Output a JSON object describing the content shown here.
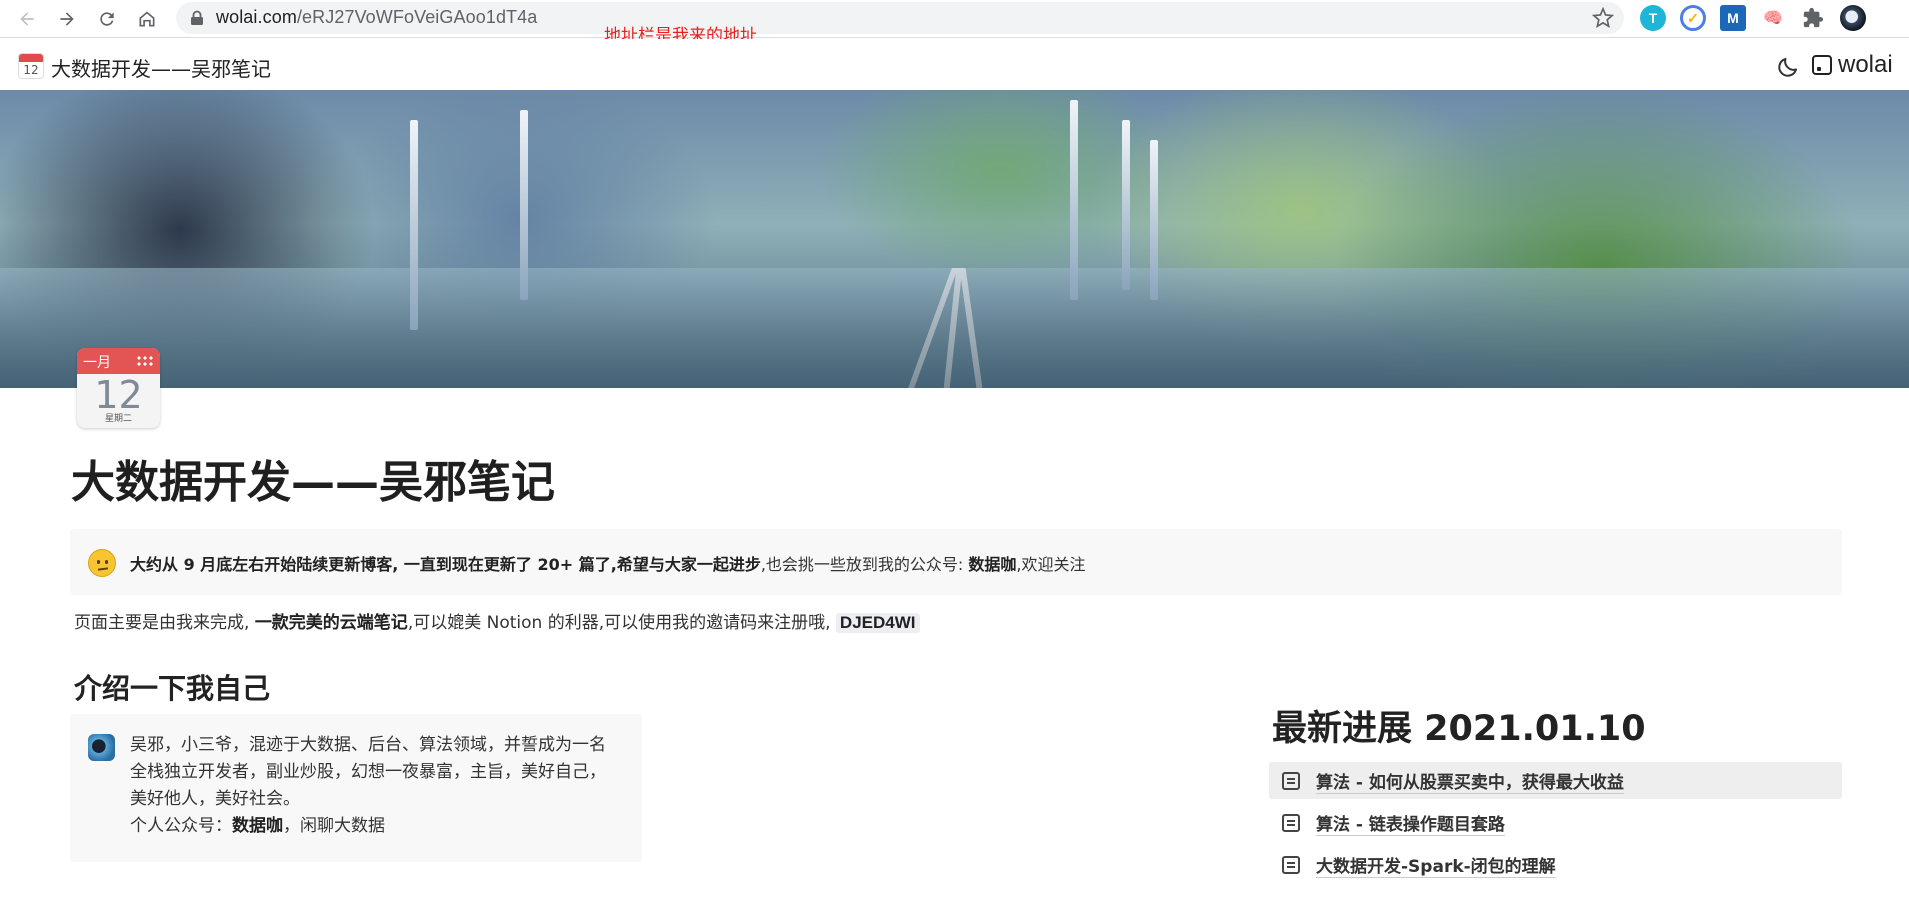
{
  "browser": {
    "url_host": "wolai.com",
    "url_path": "/eRJ27VoWFoVeiGAoo1dT4a",
    "annotation": "地址栏是我来的地址",
    "extensions": [
      "T",
      "✓",
      "M",
      "🧠"
    ]
  },
  "topbar": {
    "icon_day": "12",
    "title": "大数据开发——吴邪笔记",
    "brand": "wolai"
  },
  "page": {
    "icon": {
      "month": "一月",
      "day": "12",
      "weekday": "星期二"
    },
    "title": "大数据开发——吴邪笔记",
    "callout": {
      "bold1": "大约从 9 月底左右开始陆续更新博客, 一直到现在更新了 20+ 篇了,希望与大家一起进步",
      "normal1": ",也会挑一些放到我的公众号: ",
      "bold2": "数据咖",
      "normal2": ",欢迎关注"
    },
    "para": {
      "normal1": "页面主要是由我来完成, ",
      "bold1": "一款完美的云端笔记",
      "normal2": ",可以媲美 Notion 的利器,可以使用我的邀请码来注册哦, ",
      "code": "DJED4WI"
    },
    "intro_heading": "介绍一下我自己",
    "intro": {
      "line1": "吴邪，小三爷，混迹于大数据、后台、算法领域，并誓成为一名",
      "line2": "全栈独立开发者，副业炒股，幻想一夜暴富，主旨，美好自己，",
      "line3": "美好他人，美好社会。",
      "line4_prefix": "个人公众号：",
      "line4_bold": "数据咖",
      "line4_suffix": "，闲聊大数据"
    },
    "news_heading": "最新进展 2021.01.10",
    "news": [
      "算法 - 如何从股票买卖中，获得最大收益",
      "算法 - 链表操作题目套路",
      "大数据开发-Spark-闭包的理解"
    ]
  }
}
